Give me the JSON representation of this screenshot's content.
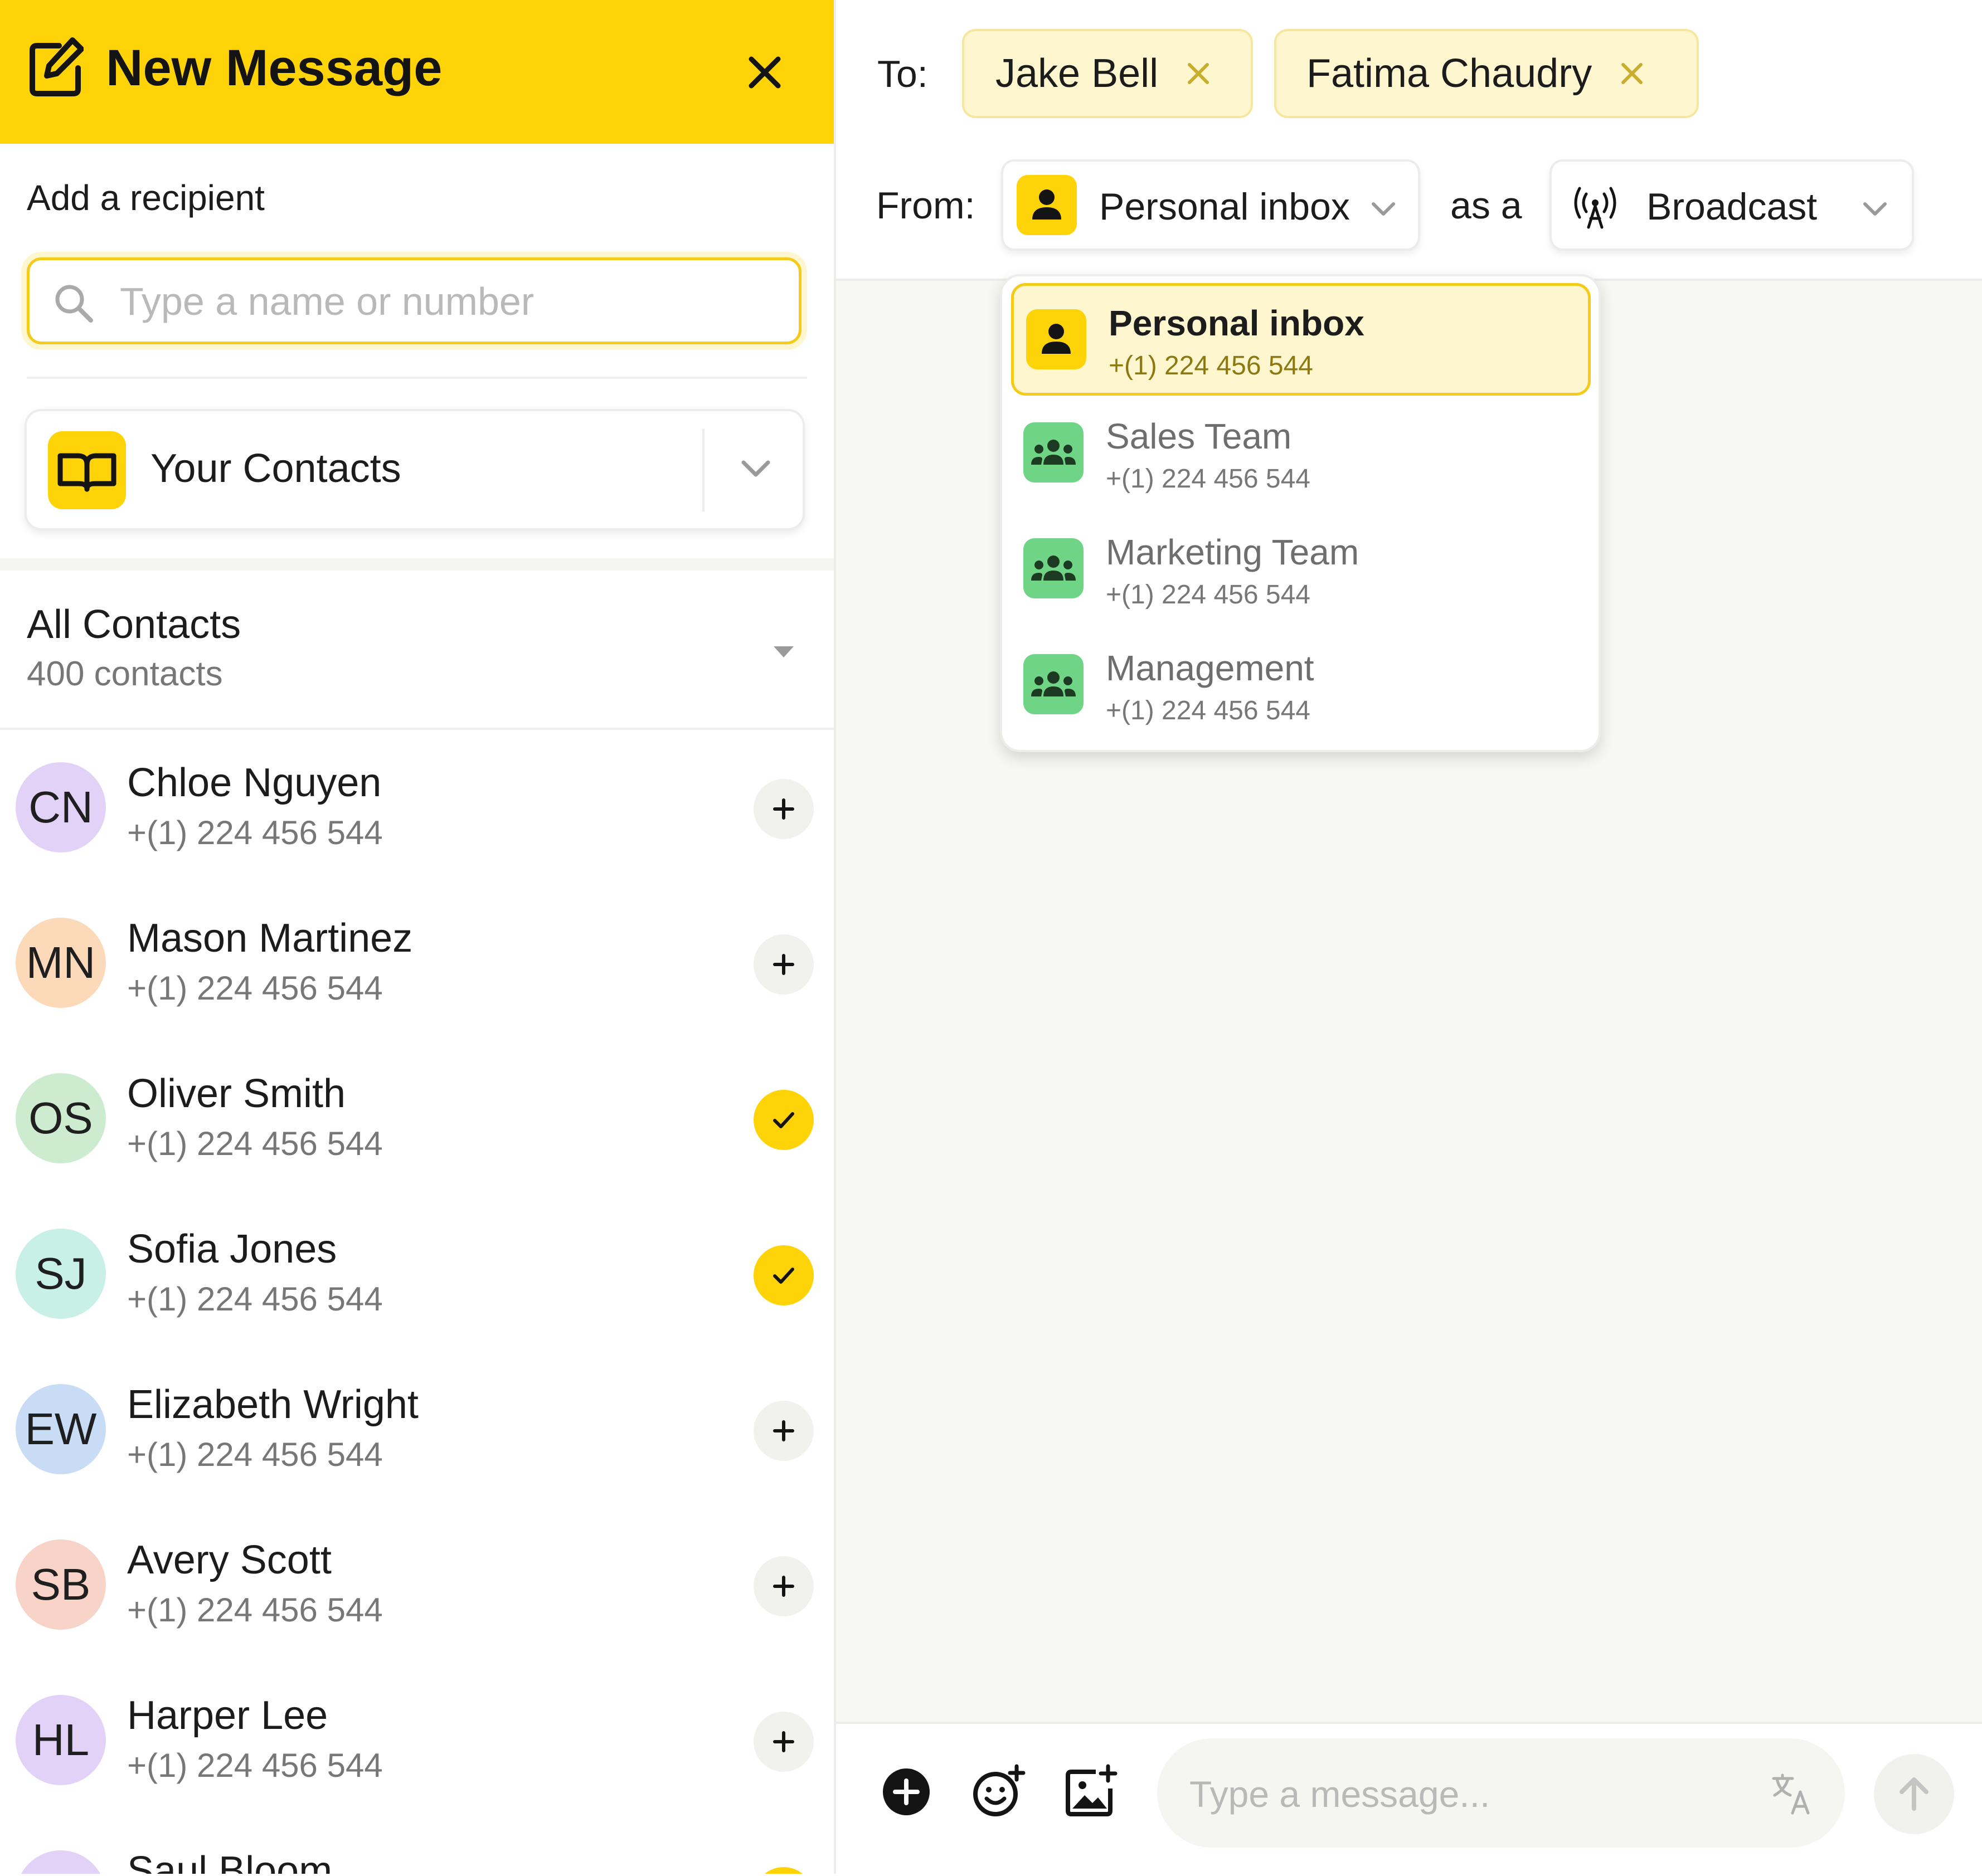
{
  "header": {
    "title": "New Message",
    "icon": "compose-icon",
    "close_icon": "close-icon",
    "color": "#fed308"
  },
  "recipient": {
    "label": "Add a recipient",
    "search_placeholder": "Type a name or number"
  },
  "contacts_selector": {
    "label": "Your Contacts",
    "icon": "book-icon"
  },
  "all_contacts": {
    "title": "All Contacts",
    "count": "400 contacts"
  },
  "contacts": [
    {
      "initials": "CN",
      "name": "Chloe Nguyen",
      "phone": "+(1) 224 456 544",
      "selected": false,
      "avatar_color": "#e3d2f7"
    },
    {
      "initials": "MN",
      "name": "Mason Martinez",
      "phone": "+(1) 224 456 544",
      "selected": false,
      "avatar_color": "#fbd9b9"
    },
    {
      "initials": "OS",
      "name": "Oliver Smith",
      "phone": "+(1) 224 456 544",
      "selected": true,
      "avatar_color": "#cdeccf"
    },
    {
      "initials": "SJ",
      "name": "Sofia Jones",
      "phone": "+(1) 224 456 544",
      "selected": true,
      "avatar_color": "#c9f0e6"
    },
    {
      "initials": "EW",
      "name": "Elizabeth Wright",
      "phone": "+(1) 224 456 544",
      "selected": false,
      "avatar_color": "#c8dcf5"
    },
    {
      "initials": "SB",
      "name": "Avery Scott",
      "phone": "+(1) 224 456 544",
      "selected": false,
      "avatar_color": "#f8d3c7"
    },
    {
      "initials": "HL",
      "name": "Harper Lee",
      "phone": "+(1) 224 456 544",
      "selected": false,
      "avatar_color": "#e3d2f7"
    },
    {
      "initials": "",
      "name": "Saul Bloom",
      "phone": "",
      "selected": true,
      "avatar_color": "#e3d2f7"
    }
  ],
  "to": {
    "label": "To:",
    "recipients": [
      {
        "name": "Jake Bell"
      },
      {
        "name": "Fatima Chaudry"
      }
    ]
  },
  "from": {
    "label": "From:",
    "selected": "Personal inbox",
    "as_label": "as a"
  },
  "mode": {
    "selected": "Broadcast",
    "icon": "broadcast-icon"
  },
  "inbox_options": [
    {
      "name": "Personal inbox",
      "phone": "+(1) 224 456 544",
      "selected": true,
      "icon": "person-icon"
    },
    {
      "name": "Sales Team",
      "phone": "+(1) 224 456 544",
      "selected": false,
      "icon": "group-icon"
    },
    {
      "name": "Marketing Team",
      "phone": "+(1) 224 456 544",
      "selected": false,
      "icon": "group-icon"
    },
    {
      "name": "Management",
      "phone": "+(1) 224 456 544",
      "selected": false,
      "icon": "group-icon"
    }
  ],
  "composer": {
    "placeholder": "Type a message..."
  },
  "colors": {
    "accent": "#fed308",
    "accent_light": "#fdf6cf",
    "team_green": "#6fd486"
  }
}
